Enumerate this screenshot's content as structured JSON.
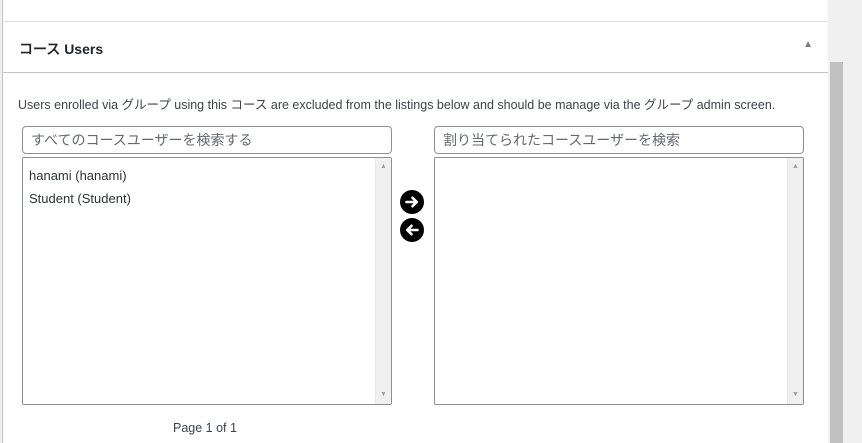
{
  "metabox": {
    "title": "コース Users",
    "toggle_icon": "▲",
    "description": "Users enrolled via グループ using this コース are excluded from the listings below and should be manage via the グループ admin screen."
  },
  "available_users": {
    "search_placeholder": "すべてのコースユーザーを検索する",
    "items": [
      {
        "label": "hanami (hanami)"
      },
      {
        "label": "Student (Student)"
      }
    ]
  },
  "assigned_users": {
    "search_placeholder": "割り当てられたコースユーザーを検索",
    "items": []
  },
  "controls": {
    "add_icon": "arrow-right-circle-icon",
    "remove_icon": "arrow-left-circle-icon"
  },
  "pagination": {
    "label": "Page 1 of 1"
  },
  "colors": {
    "button_bg": "#000000",
    "border": "#8c8f94"
  }
}
